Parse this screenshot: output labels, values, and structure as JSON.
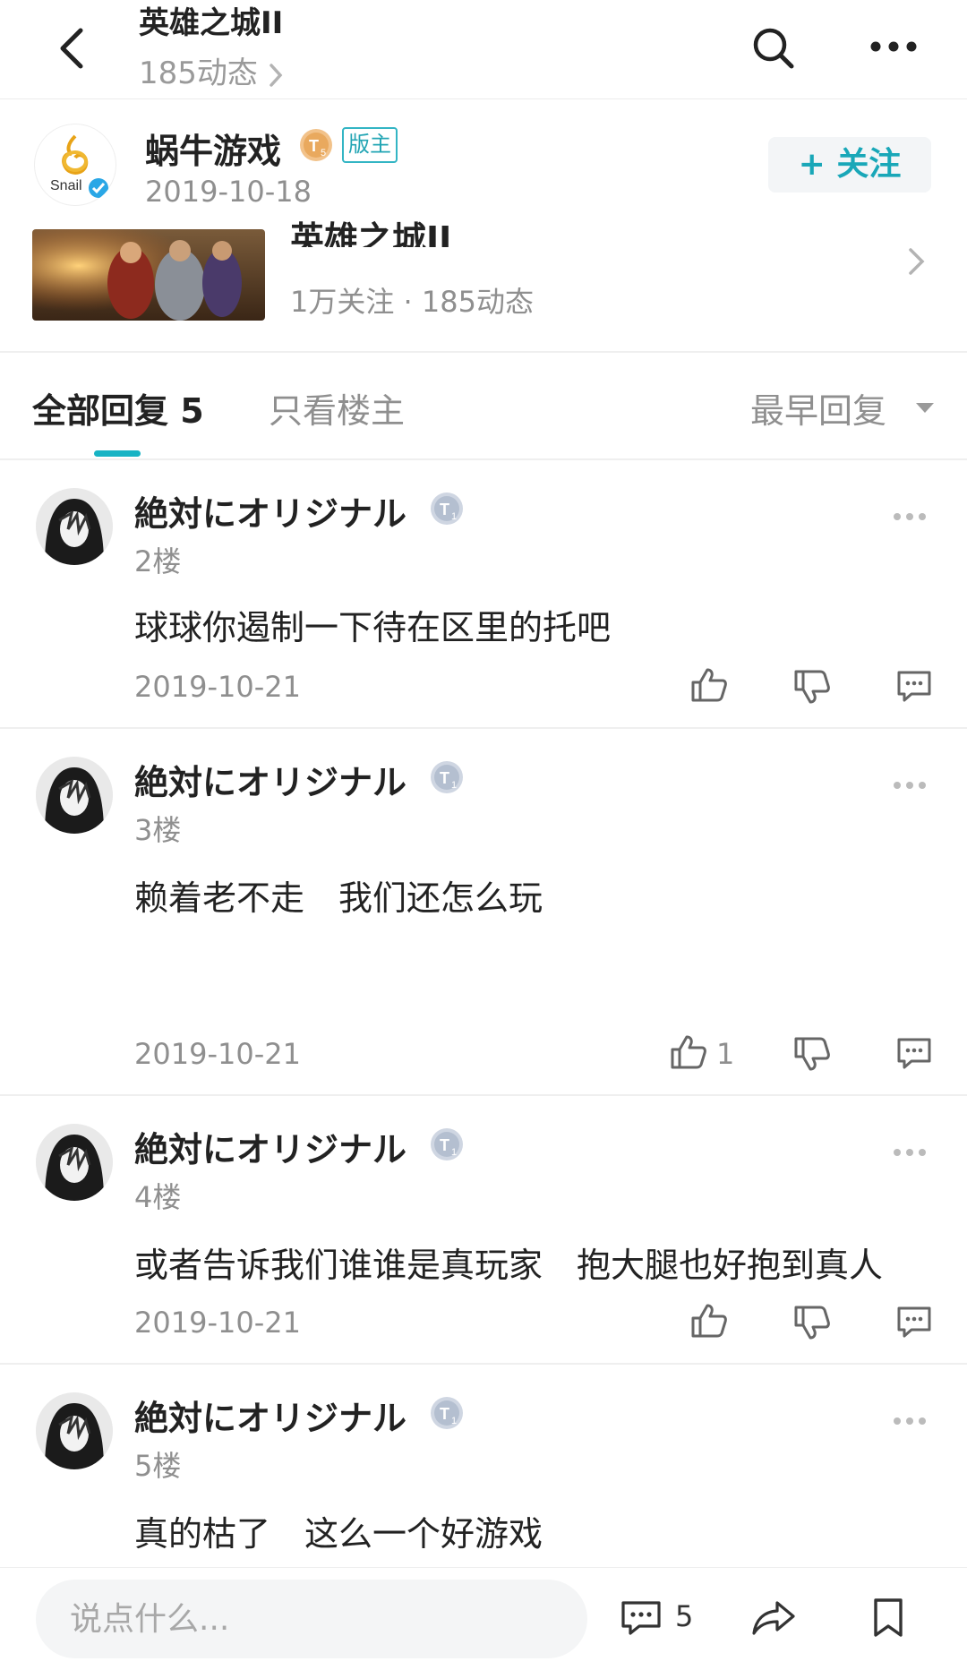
{
  "header": {
    "title": "英雄之城II",
    "subtitle": "185动态",
    "icons": {
      "back": "back-arrow-icon",
      "search": "search-icon",
      "more": "more-dots-icon"
    }
  },
  "post_author": {
    "name": "蜗牛游戏",
    "avatar_logo_text": "Snail",
    "level_badge": "T5",
    "mod_badge": "版主",
    "date": "2019-10-18",
    "follow_label": "+ 关注"
  },
  "game_card": {
    "name": "英雄之城II",
    "stats": "1万关注 · 185动态"
  },
  "tabs": {
    "all_label": "全部回复 5",
    "owner_label": "只看楼主",
    "sort_label": "最早回复"
  },
  "comments": [
    {
      "name": "絶対にオリジナル",
      "level": "T1",
      "floor": "2楼",
      "text": "球球你遏制一下待在区里的托吧",
      "date": "2019-10-21",
      "likes": ""
    },
    {
      "name": "絶対にオリジナル",
      "level": "T1",
      "floor": "3楼",
      "text": "赖着老不走　我们还怎么玩",
      "date": "2019-10-21",
      "likes": "1"
    },
    {
      "name": "絶対にオリジナル",
      "level": "T1",
      "floor": "4楼",
      "text": "或者告诉我们谁谁是真玩家　抱大腿也好抱到真人",
      "date": "2019-10-21",
      "likes": ""
    },
    {
      "name": "絶対にオリジナル",
      "level": "T1",
      "floor": "5楼",
      "text": "真的枯了　这么一个好游戏",
      "date": "",
      "likes": ""
    }
  ],
  "bottom_bar": {
    "placeholder": "说点什么...",
    "comment_count": "5"
  },
  "colors": {
    "accent": "#17b3c4",
    "text_primary": "#222222",
    "text_secondary": "#8f8f8f"
  }
}
